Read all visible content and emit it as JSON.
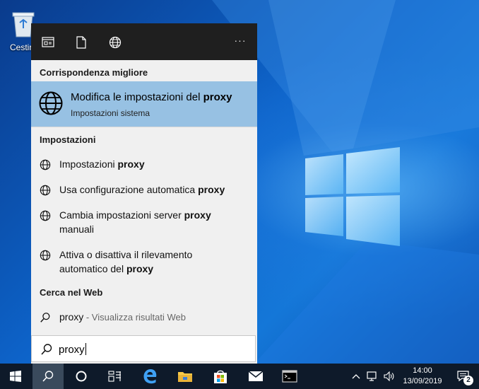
{
  "desktop": {
    "icon_label": "Cestir"
  },
  "panel": {
    "header": {
      "more": "···"
    },
    "best_match_heading": "Corrispondenza migliore",
    "best_match": {
      "title_prefix": "Modifica le impostazioni del ",
      "title_bold": "proxy",
      "subtitle": "Impostazioni sistema"
    },
    "settings_heading": "Impostazioni",
    "settings": [
      {
        "prefix": "Impostazioni ",
        "bold": "proxy",
        "line2": ""
      },
      {
        "prefix": "Usa configurazione automatica ",
        "bold": "proxy",
        "line2": ""
      },
      {
        "prefix": "Cambia impostazioni server ",
        "bold": "proxy",
        "line2": "manuali"
      },
      {
        "prefix": "Attiva o disattiva il rilevamento",
        "bold": "",
        "line2_prefix": "automatico del ",
        "line2_bold": "proxy"
      }
    ],
    "web_heading": "Cerca nel Web",
    "web": {
      "query": "proxy",
      "hint": " - Visualizza risultati Web"
    }
  },
  "search_box": {
    "value": "proxy"
  },
  "clock": {
    "time": "14:00",
    "date": "13/09/2019"
  },
  "notifications": {
    "count": "2"
  },
  "colors": {
    "accent_selected": "#97c1e3",
    "panel_bg": "#f0f0f0",
    "header_bg": "#1f1f1f",
    "taskbar_bg": "#0e1a2a"
  }
}
